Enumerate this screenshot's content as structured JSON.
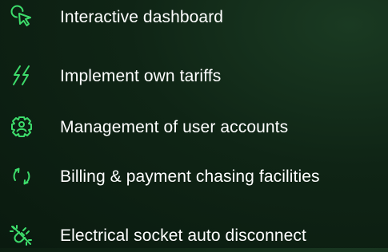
{
  "accent_color": "#3ddc6b",
  "features": [
    {
      "icon": "pointer-click-icon",
      "label": "Interactive dashboard"
    },
    {
      "icon": "lightning-bolts-icon",
      "label": "Implement own tariffs"
    },
    {
      "icon": "user-gear-icon",
      "label": "Management of user accounts"
    },
    {
      "icon": "refresh-cycle-icon",
      "label": "Billing & payment chasing facilities"
    },
    {
      "icon": "unplug-icon",
      "label": "Electrical socket auto disconnect"
    }
  ]
}
